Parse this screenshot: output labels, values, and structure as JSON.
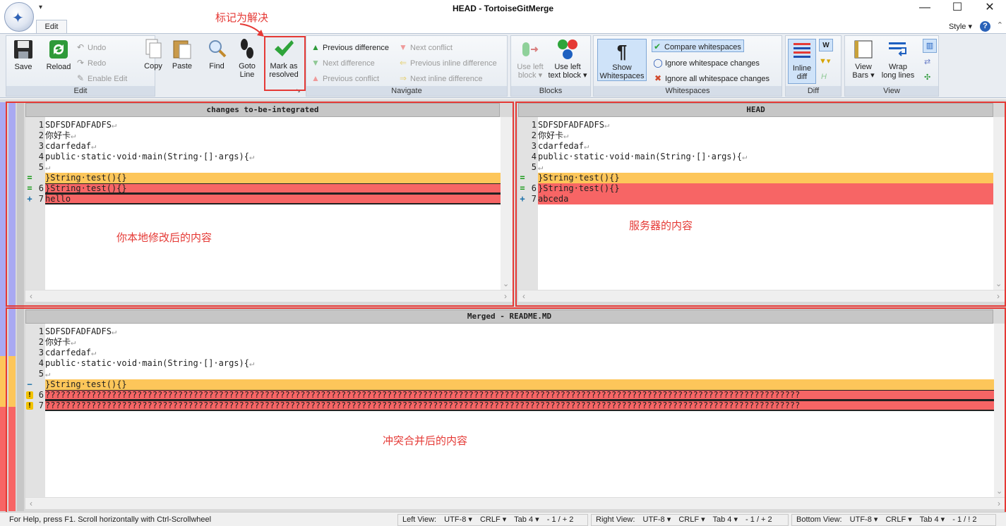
{
  "window": {
    "title": "HEAD - TortoiseGitMerge",
    "minimize": "—",
    "maximize": "☐",
    "close": "✕"
  },
  "ribbon": {
    "tab": "Edit",
    "style_menu": "Style",
    "help": "?",
    "groups": {
      "edit": "Edit",
      "navigate": "Navigate",
      "blocks": "Blocks",
      "whitespaces": "Whitespaces",
      "diff": "Diff",
      "view": "View"
    },
    "save": "Save",
    "reload": "Reload",
    "undo": "Undo",
    "redo": "Redo",
    "enable_edit": "Enable Edit",
    "copy": "Copy",
    "paste": "Paste",
    "find": "Find",
    "goto_line_1": "Goto",
    "goto_line_2": "Line",
    "mark_resolved_1": "Mark as",
    "mark_resolved_2": "resolved",
    "previous_difference": "Previous difference",
    "next_difference": "Next difference",
    "previous_conflict": "Previous conflict",
    "next_conflict": "Next conflict",
    "previous_inline_difference": "Previous inline difference",
    "next_inline_difference": "Next inline difference",
    "use_left_block_1": "Use left",
    "use_left_block_2": "block ▾",
    "use_left_text_block_1": "Use left",
    "use_left_text_block_2": "text block ▾",
    "show_whitespaces_1": "Show",
    "show_whitespaces_2": "Whitespaces",
    "compare_whitespaces": "Compare whitespaces",
    "ignore_whitespace_changes": "Ignore whitespace changes",
    "ignore_all_whitespace_changes": "Ignore all whitespace changes",
    "inline_diff_1": "Inline",
    "inline_diff_2": "diff",
    "view_bars_1": "View",
    "view_bars_2": "Bars ▾",
    "wrap_long_lines_1": "Wrap",
    "wrap_long_lines_2": "long lines"
  },
  "annotations": {
    "mark_resolved": "标记为解决",
    "local": "你本地修改后的内容",
    "server": "服务器的内容",
    "merged": "冲突合并后的内容"
  },
  "panes": {
    "left": {
      "title": "changes to-be-integrated",
      "lines": [
        {
          "mark": "",
          "num": "1",
          "text": "SDFSDFADFADFS",
          "eol": "↵",
          "bg": ""
        },
        {
          "mark": "",
          "num": "2",
          "text": "你好卡",
          "eol": "↵",
          "bg": ""
        },
        {
          "mark": "",
          "num": "3",
          "text": "cdarfedaf",
          "eol": "↵",
          "bg": ""
        },
        {
          "mark": "",
          "num": "4",
          "text": "public·static·void·main(String·[]·args){",
          "eol": "↵",
          "bg": ""
        },
        {
          "mark": "",
          "num": "5",
          "text": "",
          "eol": "↵",
          "bg": ""
        },
        {
          "mark": "=",
          "num": "",
          "text": "}String·test(){}",
          "eol": "",
          "bg": "orange"
        },
        {
          "mark": "=",
          "num": "6",
          "text": "}String·test(){}",
          "eol": "",
          "bg": "red-bordered"
        },
        {
          "mark": "+",
          "num": "7",
          "text": "hello",
          "eol": "",
          "bg": "red-bordered"
        }
      ]
    },
    "right": {
      "title": "HEAD",
      "lines": [
        {
          "mark": "",
          "num": "1",
          "text": "SDFSDFADFADFS",
          "eol": "↵",
          "bg": ""
        },
        {
          "mark": "",
          "num": "2",
          "text": "你好卡",
          "eol": "↵",
          "bg": ""
        },
        {
          "mark": "",
          "num": "3",
          "text": "cdarfedaf",
          "eol": "↵",
          "bg": ""
        },
        {
          "mark": "",
          "num": "4",
          "text": "public·static·void·main(String·[]·args){",
          "eol": "↵",
          "bg": ""
        },
        {
          "mark": "",
          "num": "5",
          "text": "",
          "eol": "↵",
          "bg": ""
        },
        {
          "mark": "=",
          "num": "",
          "text": "}String·test(){}",
          "eol": "",
          "bg": "orange"
        },
        {
          "mark": "=",
          "num": "6",
          "text": "}String·test(){}",
          "eol": "",
          "bg": "red"
        },
        {
          "mark": "+",
          "num": "7",
          "text": "abceda",
          "eol": "",
          "bg": "red"
        }
      ]
    },
    "merged": {
      "title": "Merged - README.MD",
      "lines": [
        {
          "mark": "",
          "num": "1",
          "text": "SDFSDFADFADFS",
          "eol": "↵",
          "bg": ""
        },
        {
          "mark": "",
          "num": "2",
          "text": "你好卡",
          "eol": "↵",
          "bg": ""
        },
        {
          "mark": "",
          "num": "3",
          "text": "cdarfedaf",
          "eol": "↵",
          "bg": ""
        },
        {
          "mark": "",
          "num": "4",
          "text": "public·static·void·main(String·[]·args){",
          "eol": "↵",
          "bg": ""
        },
        {
          "mark": "",
          "num": "5",
          "text": "",
          "eol": "↵",
          "bg": ""
        },
        {
          "mark": "−",
          "num": "",
          "text": "}String·test(){}",
          "eol": "",
          "bg": "orange"
        },
        {
          "mark": "!",
          "num": "6",
          "text": "????????????????????????????????????????????????????????????????????????????????????????????????????????????????????????????????????????????????????",
          "eol": "",
          "bg": "red-bordered"
        },
        {
          "mark": "!",
          "num": "7",
          "text": "????????????????????????????????????????????????????????????????????????????????????????????????????????????????????????????????????????????????????",
          "eol": "",
          "bg": "red-bordered"
        }
      ]
    }
  },
  "status": {
    "help": "For Help, press F1. Scroll horizontally with Ctrl-Scrollwheel",
    "left_view": {
      "label": "Left View:",
      "encoding": "UTF-8 ▾",
      "eol": "CRLF ▾",
      "tab": "Tab 4 ▾",
      "counts": "- 1 / + 2"
    },
    "right_view": {
      "label": "Right View:",
      "encoding": "UTF-8 ▾",
      "eol": "CRLF ▾",
      "tab": "Tab 4 ▾",
      "counts": "- 1 / + 2"
    },
    "bottom_view": {
      "label": "Bottom View:",
      "encoding": "UTF-8 ▾",
      "eol": "CRLF ▾",
      "tab": "Tab 4 ▾",
      "counts": "- 1 / ! 2"
    }
  },
  "colors": {
    "conflict_red": "#f76565",
    "moved_orange": "#fdc65a",
    "annotation_red": "#e53935",
    "left_gutter_blue": "#a9a9f2"
  }
}
